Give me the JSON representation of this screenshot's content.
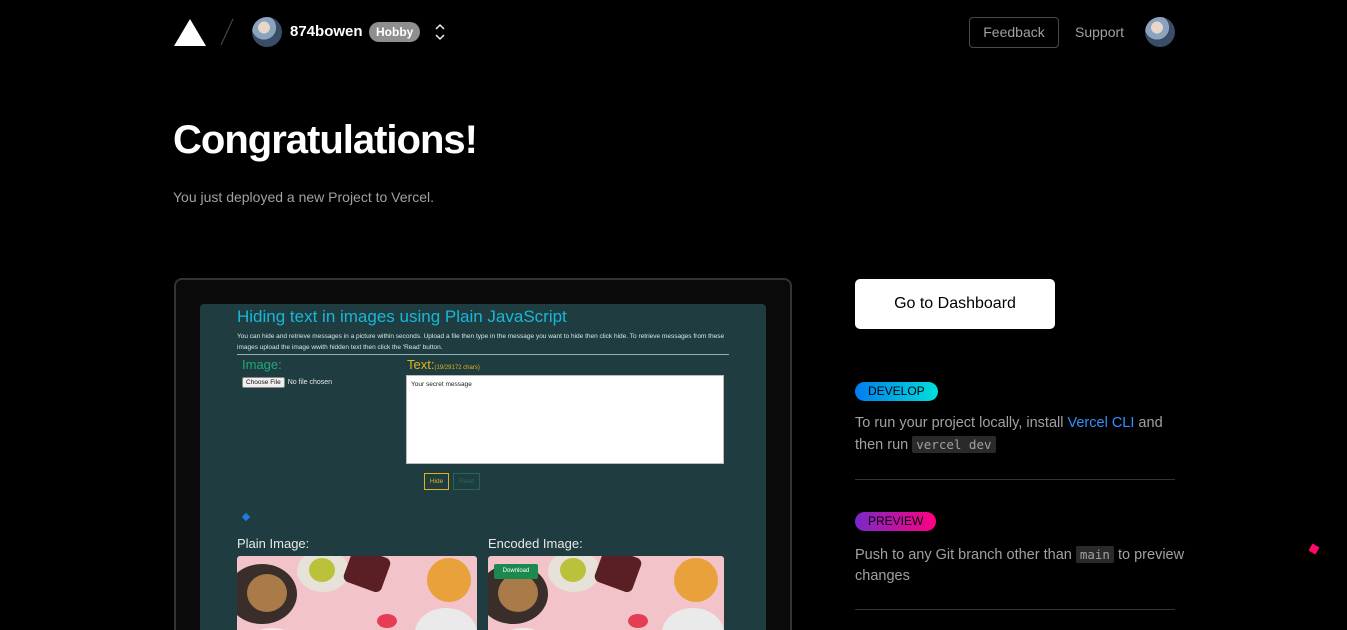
{
  "header": {
    "logo_icon": "vercel-triangle-icon",
    "username": "874bowen",
    "plan": "Hobby",
    "feedback_label": "Feedback",
    "support_label": "Support"
  },
  "hero": {
    "title": "Congratulations!",
    "subtitle": "You just deployed a new Project to Vercel."
  },
  "preview": {
    "title": "Hiding text in images using Plain JavaScript",
    "description": "You can hide and retrieve messages in a picture within seconds. Upload a file then type in the message you want to hide then click hide. To retrieve messages from these images upload the image wwith hidden text then click the 'Read' button.",
    "image_label": "Image:",
    "text_label": "Text:",
    "chars": "(19/29172 chars)",
    "choose_file": "Choose File",
    "no_file": "No file chosen",
    "textarea_value": "Your secret message",
    "hide_label": "Hide",
    "read_label": "Read",
    "plain_image_label": "Plain Image:",
    "encoded_image_label": "Encoded Image:",
    "download_label": "Download"
  },
  "actions": {
    "dashboard_label": "Go to Dashboard"
  },
  "develop": {
    "badge": "DEVELOP",
    "text_before": "To run your project locally, install ",
    "link": "Vercel CLI",
    "text_after": " and then run ",
    "code": "vercel dev"
  },
  "preview_section": {
    "badge": "PREVIEW",
    "text_before": "Push to any Git branch other than ",
    "code": "main",
    "text_after": " to preview changes"
  },
  "colors": {
    "develop_gradient": [
      "#007cf0",
      "#00dfd8"
    ],
    "preview_gradient": [
      "#7928ca",
      "#ff0080"
    ],
    "link": "#3291ff"
  }
}
